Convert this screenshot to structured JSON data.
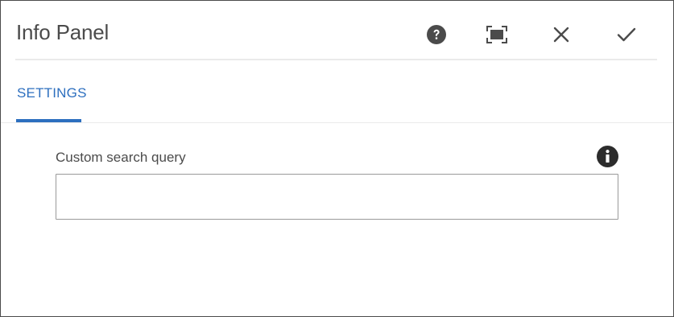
{
  "dialog": {
    "title": "Info Panel",
    "actions": {
      "help_icon": "help-icon",
      "fullscreen_icon": "fullscreen-icon",
      "close_icon": "close-icon",
      "confirm_icon": "checkmark-icon"
    }
  },
  "tabs": [
    {
      "label": "SETTINGS",
      "active": true
    }
  ],
  "form": {
    "custom_search_query": {
      "label": "Custom search query",
      "value": "",
      "placeholder": "",
      "info_icon": "info-icon"
    }
  },
  "colors": {
    "accent": "#2d6fbf",
    "text": "#4b4b4b",
    "border": "#9a9a9a",
    "divider": "#eaeaea"
  }
}
